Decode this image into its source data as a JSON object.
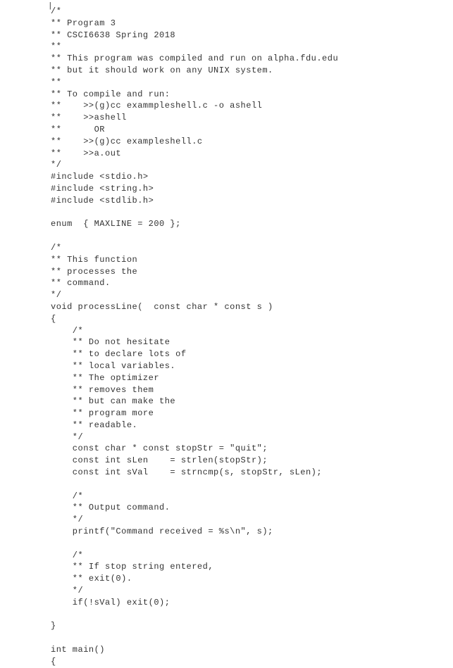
{
  "code": {
    "lines": [
      "/*",
      "** Program 3",
      "** CSCI6638 Spring 2018",
      "**",
      "** This program was compiled and run on alpha.fdu.edu",
      "** but it should work on any UNIX system.",
      "**",
      "** To compile and run:",
      "**    >>(g)cc exammpleshell.c -o ashell",
      "**    >>ashell",
      "**      OR",
      "**    >>(g)cc exampleshell.c",
      "**    >>a.out",
      "*/",
      "#include <stdio.h>",
      "#include <string.h>",
      "#include <stdlib.h>",
      "",
      "enum  { MAXLINE = 200 };",
      "",
      "/*",
      "** This function",
      "** processes the",
      "** command.",
      "*/",
      "void processLine(  const char * const s )",
      "{",
      "    /*",
      "    ** Do not hesitate",
      "    ** to declare lots of",
      "    ** local variables.",
      "    ** The optimizer",
      "    ** removes them",
      "    ** but can make the",
      "    ** program more",
      "    ** readable.",
      "    */",
      "    const char * const stopStr = \"quit\";",
      "    const int sLen    = strlen(stopStr);",
      "    const int sVal    = strncmp(s, stopStr, sLen);",
      "",
      "    /*",
      "    ** Output command.",
      "    */",
      "    printf(\"Command received = %s\\n\", s);",
      "",
      "    /*",
      "    ** If stop string entered,",
      "    ** exit(0).",
      "    */",
      "    if(!sVal) exit(0);",
      "",
      "}",
      "",
      "int main()",
      "{"
    ]
  },
  "cursor_char": "|"
}
